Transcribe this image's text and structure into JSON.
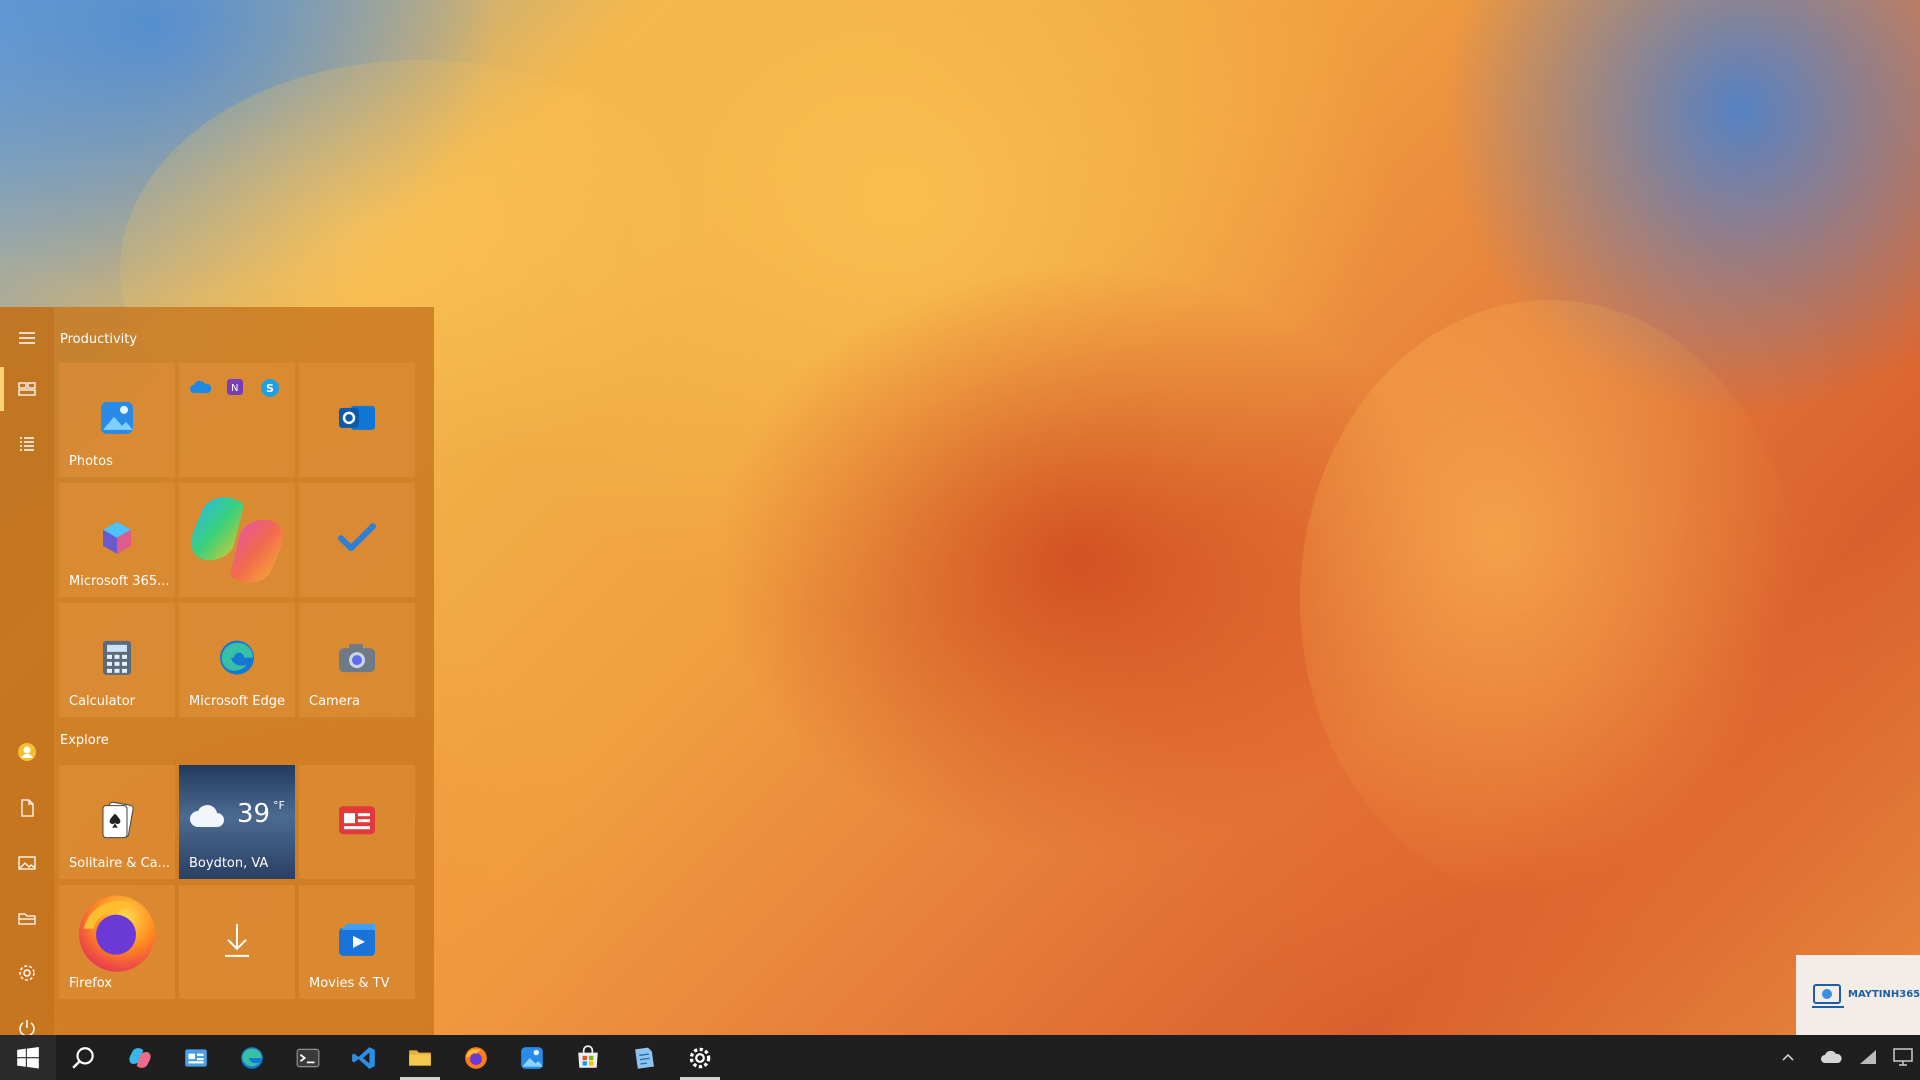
{
  "start_menu": {
    "groups": [
      {
        "label": "Productivity"
      },
      {
        "label": "Explore"
      }
    ],
    "tiles": {
      "photos": {
        "label": "Photos"
      },
      "office_group": {
        "label": ""
      },
      "outlook": {
        "label": ""
      },
      "m365": {
        "label": "Microsoft 365..."
      },
      "copilot": {
        "label": ""
      },
      "todo": {
        "label": ""
      },
      "calculator": {
        "label": "Calculator"
      },
      "edge": {
        "label": "Microsoft Edge"
      },
      "camera": {
        "label": "Camera"
      },
      "solitaire": {
        "label": "Solitaire & Ca..."
      },
      "weather": {
        "label": "Boydton, VA",
        "temperature": "39",
        "unit": "°F"
      },
      "news": {
        "label": ""
      },
      "firefox": {
        "label": "Firefox"
      },
      "download": {
        "label": ""
      },
      "movies": {
        "label": "Movies & TV"
      }
    },
    "rail_icons": [
      "hamburger-icon",
      "tiles-icon",
      "list-icon",
      "user-icon",
      "document-icon",
      "pictures-icon",
      "folder-icon",
      "gear-icon",
      "power-icon"
    ]
  },
  "taskbar": {
    "items": [
      "windows-logo-icon",
      "search-icon",
      "copilot-icon",
      "news-icon",
      "edge-icon",
      "terminal-icon",
      "vscode-icon",
      "file-explorer-icon",
      "firefox-icon",
      "photos-icon",
      "store-icon",
      "notepad-icon",
      "settings-icon"
    ]
  },
  "watermark": {
    "text": "MAYTINH365"
  },
  "colors": {
    "start_menu_bg": "#c8781e",
    "tile_bg": "#e1913c",
    "taskbar_bg": "#1f1f1f"
  }
}
